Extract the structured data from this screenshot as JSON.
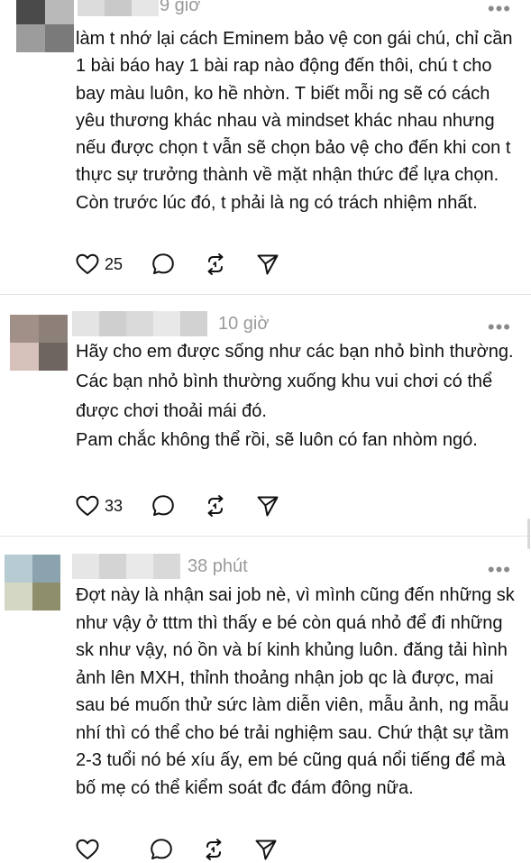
{
  "colors": {
    "text": "#111111",
    "muted": "#9a9a9a",
    "divider": "#e3e3e3"
  },
  "posts": [
    {
      "time": "9 giờ",
      "more": "•••",
      "avatar_colors": [
        "#4a4a4a",
        "#b9b9b9",
        "#9c9c9c",
        "#7a7a7a"
      ],
      "name_colors": [
        "#dcdcdc",
        "#c9c9c9",
        "#e6e6e6"
      ],
      "paragraphs": [
        "làm t nhớ lại cách Eminem bảo vệ con gái chú, chỉ cần 1 bài báo hay 1 bài rap nào động đến thôi, chú t cho bay màu luôn, ko hề nhờn. T biết mỗi ng sẽ có cách yêu thương khác nhau và mindset khác nhau nhưng nếu được chọn t vẫn sẽ chọn bảo vệ cho đến khi con t thực sự trưởng thành về mặt nhận thức để lựa chọn. Còn trước lúc đó, t phải là ng có trách nhiệm nhất."
      ],
      "likes": "25",
      "icons": [
        "heart-icon",
        "comment-icon",
        "repost-icon",
        "share-icon"
      ]
    },
    {
      "time": "10 giờ",
      "more": "•••",
      "avatar_colors": [
        "#a09088",
        "#8c8078",
        "#d6c2ba",
        "#6e6460"
      ],
      "name_colors": [
        "#e4e4e4",
        "#cfcfcf",
        "#dadada",
        "#e8e8e8",
        "#d2d2d2"
      ],
      "paragraphs": [
        "Hãy cho em được sống như các bạn nhỏ bình thường.",
        "Các bạn nhỏ bình thường xuống khu vui chơi có thể được chơi thoải mái đó.",
        "Pam chắc không thể rồi, sẽ luôn có fan nhòm ngó."
      ],
      "likes": "33",
      "icons": [
        "heart-icon",
        "comment-icon",
        "repost-icon",
        "share-icon"
      ]
    },
    {
      "time": "38 phút",
      "more": "•••",
      "avatar_colors": [
        "#b7cbd3",
        "#8aa3ae",
        "#d4d7c3",
        "#8f8e6a"
      ],
      "name_colors": [
        "#e6e6e6",
        "#d4d4d4",
        "#e9e9e9",
        "#d9d9d9"
      ],
      "paragraphs": [
        "Đợt này là nhận sai job nè, vì mình cũng đến những sk như vậy ở tttm thì thấy e bé còn quá nhỏ để đi những sk như vậy, nó ồn và bí kinh khủng luôn. đăng tải hình ảnh lên MXH, thỉnh thoảng nhận job qc là được, mai sau bé muốn thử sức làm diễn viên, mẫu ảnh, ng mẫu nhí thì có thể cho bé trải nghiệm sau. Chứ thật sự tầm 2-3 tuổi nó bé xíu ấy, em bé cũng quá nổi tiếng để mà bố mẹ có thể kiểm soát đc đám đông nữa."
      ],
      "icons": [
        "heart-icon",
        "comment-icon",
        "repost-icon",
        "share-icon"
      ]
    }
  ]
}
